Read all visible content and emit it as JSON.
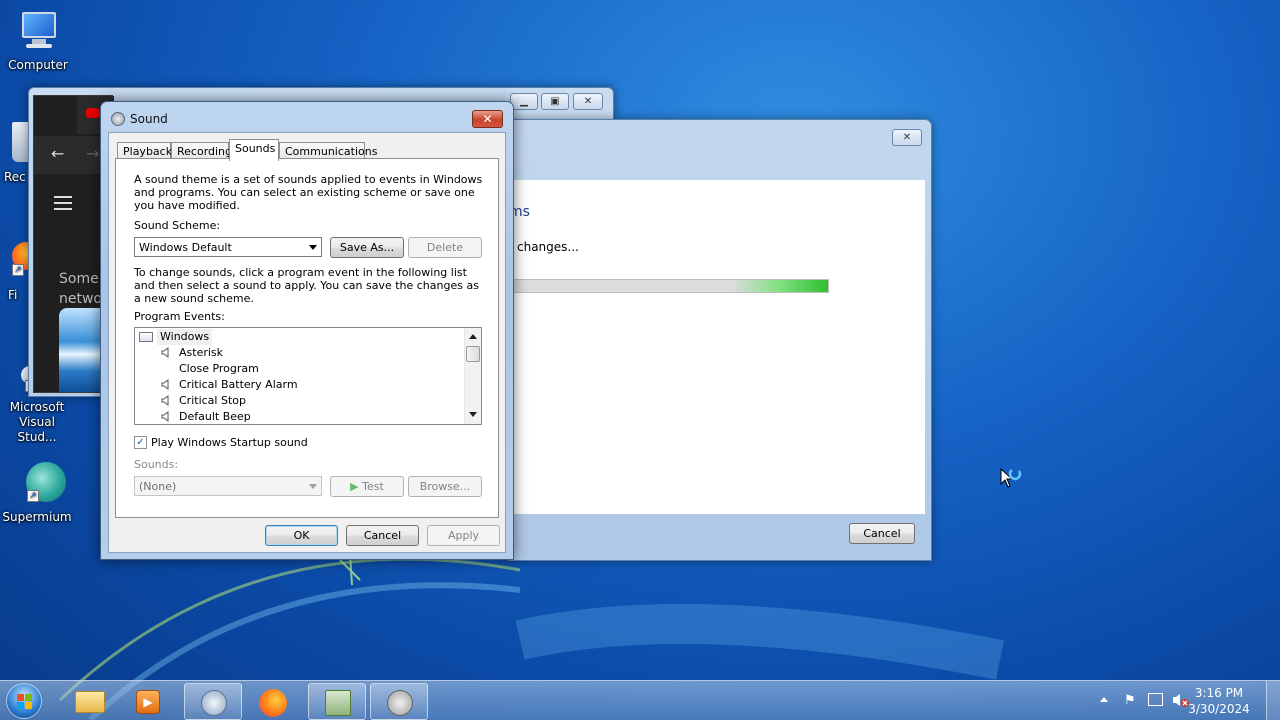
{
  "desktop": {
    "icons": [
      {
        "label": "Computer"
      },
      {
        "label": "Rec"
      },
      {
        "label": "Fi"
      },
      {
        "label": "Microsoft Visual Stud..."
      },
      {
        "label": "Supermium"
      }
    ]
  },
  "browser_window": {
    "partial_text_line1": "Some",
    "partial_text_line2": "netwo"
  },
  "installer_window": {
    "heading_partial": "ms",
    "status_partial": "changes...",
    "progress_fraction": 1.0,
    "cancel_label": "Cancel"
  },
  "sound_dialog": {
    "title": "Sound",
    "tabs": [
      "Playback",
      "Recording",
      "Sounds",
      "Communications"
    ],
    "active_tab": "Sounds",
    "intro_text": "A sound theme is a set of sounds applied to events in Windows and programs.  You can select an existing scheme or save one you have modified.",
    "scheme_label": "Sound Scheme:",
    "scheme_value": "Windows Default",
    "save_as_label": "Save As...",
    "delete_label": "Delete",
    "instructions_text": "To change sounds, click a program event in the following list and then select a sound to apply.  You can save the changes as a new sound scheme.",
    "program_events_label": "Program Events:",
    "events_group": "Windows",
    "events": [
      {
        "name": "Asterisk",
        "has_sound": true
      },
      {
        "name": "Close Program",
        "has_sound": false
      },
      {
        "name": "Critical Battery Alarm",
        "has_sound": true
      },
      {
        "name": "Critical Stop",
        "has_sound": true
      },
      {
        "name": "Default Beep",
        "has_sound": true
      }
    ],
    "startup_sound_label": "Play Windows Startup sound",
    "startup_sound_checked": true,
    "sounds_label": "Sounds:",
    "sounds_value": "(None)",
    "test_label": "Test",
    "browse_label": "Browse...",
    "ok_label": "OK",
    "cancel_label": "Cancel",
    "apply_label": "Apply"
  },
  "taskbar": {
    "time": "3:16 PM",
    "date": "3/30/2024"
  }
}
